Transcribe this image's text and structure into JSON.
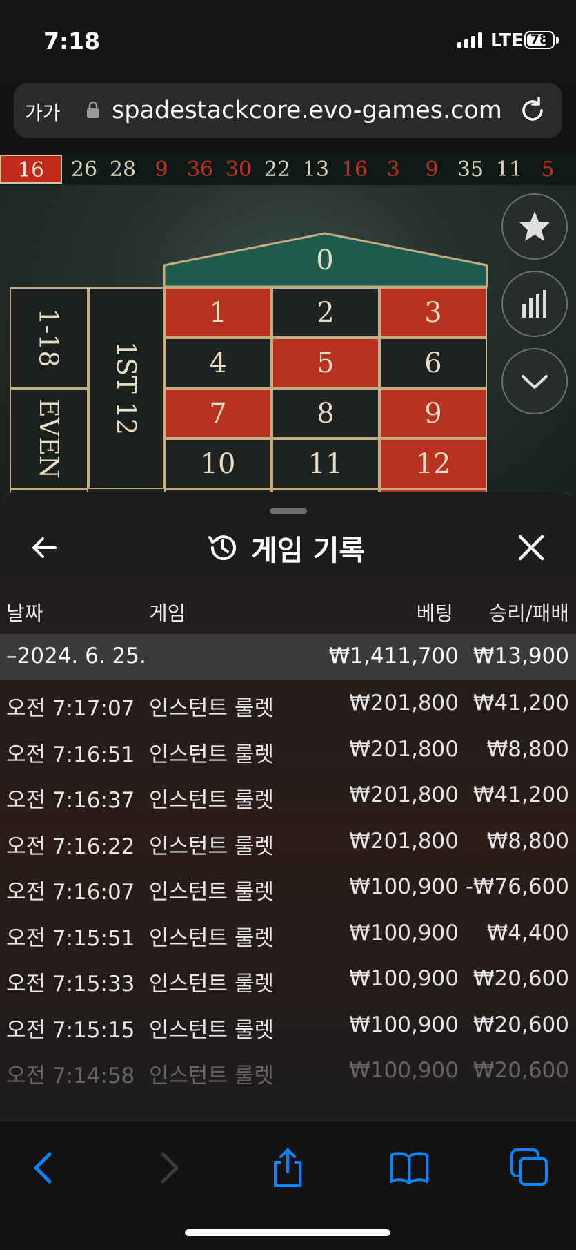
{
  "status": {
    "time": "7:18",
    "network": "LTE",
    "battery": "78",
    "battery_level": 0.78
  },
  "browser": {
    "text_size": "가가",
    "url": "spadestackcore.evo-games.com"
  },
  "history_numbers": [
    {
      "n": "16",
      "c": "red"
    },
    {
      "n": "26",
      "c": "black"
    },
    {
      "n": "28",
      "c": "black"
    },
    {
      "n": "9",
      "c": "red"
    },
    {
      "n": "36",
      "c": "red"
    },
    {
      "n": "30",
      "c": "red"
    },
    {
      "n": "22",
      "c": "black"
    },
    {
      "n": "13",
      "c": "black"
    },
    {
      "n": "16",
      "c": "red"
    },
    {
      "n": "3",
      "c": "red"
    },
    {
      "n": "9",
      "c": "red"
    },
    {
      "n": "35",
      "c": "black"
    },
    {
      "n": "11",
      "c": "black"
    },
    {
      "n": "5",
      "c": "red"
    }
  ],
  "board": {
    "zero": "0",
    "cells": [
      {
        "n": "1",
        "c": "red"
      },
      {
        "n": "2",
        "c": "black"
      },
      {
        "n": "3",
        "c": "red"
      },
      {
        "n": "4",
        "c": "black"
      },
      {
        "n": "5",
        "c": "red"
      },
      {
        "n": "6",
        "c": "black"
      },
      {
        "n": "7",
        "c": "red"
      },
      {
        "n": "8",
        "c": "black"
      },
      {
        "n": "9",
        "c": "red"
      },
      {
        "n": "10",
        "c": "black"
      },
      {
        "n": "11",
        "c": "black"
      },
      {
        "n": "12",
        "c": "red"
      }
    ],
    "low": "1-18",
    "even": "EVEN",
    "dozen": "1ST 12"
  },
  "sheet": {
    "title": "게임 기록",
    "headers": {
      "date": "날짜",
      "game": "게임",
      "bet": "베팅",
      "result": "승리/패배"
    },
    "date_row": {
      "date": "–2024. 6. 25.",
      "bet": "₩1,411,700",
      "result": "₩13,900"
    },
    "rows": [
      {
        "time": "오전 7:17:07",
        "game": "인스턴트 룰렛",
        "bet": "₩201,800",
        "result": "₩41,200"
      },
      {
        "time": "오전 7:16:51",
        "game": "인스턴트 룰렛",
        "bet": "₩201,800",
        "result": "₩8,800"
      },
      {
        "time": "오전 7:16:37",
        "game": "인스턴트 룰렛",
        "bet": "₩201,800",
        "result": "₩41,200"
      },
      {
        "time": "오전 7:16:22",
        "game": "인스턴트 룰렛",
        "bet": "₩201,800",
        "result": "₩8,800"
      },
      {
        "time": "오전 7:16:07",
        "game": "인스턴트 룰렛",
        "bet": "₩100,900",
        "result": "-₩76,600"
      },
      {
        "time": "오전 7:15:51",
        "game": "인스턴트 룰렛",
        "bet": "₩100,900",
        "result": "₩4,400"
      },
      {
        "time": "오전 7:15:33",
        "game": "인스턴트 룰렛",
        "bet": "₩100,900",
        "result": "₩20,600"
      },
      {
        "time": "오전 7:15:15",
        "game": "인스턴트 룰렛",
        "bet": "₩100,900",
        "result": "₩20,600"
      },
      {
        "time": "오전 7:14:58",
        "game": "인스턴트 룰렛",
        "bet": "₩100,900",
        "result": "₩20,600"
      }
    ]
  },
  "colors": {
    "accent": "#0a84ff",
    "red": "#b8311f",
    "felt": "#26312d"
  },
  "icons": [
    "star-icon",
    "stats-icon",
    "chevron-down-icon",
    "back-arrow-icon",
    "history-icon",
    "close-icon",
    "reload-icon",
    "lock-icon",
    "safari-back-icon",
    "safari-forward-icon",
    "share-icon",
    "bookmarks-icon",
    "tabs-icon"
  ]
}
